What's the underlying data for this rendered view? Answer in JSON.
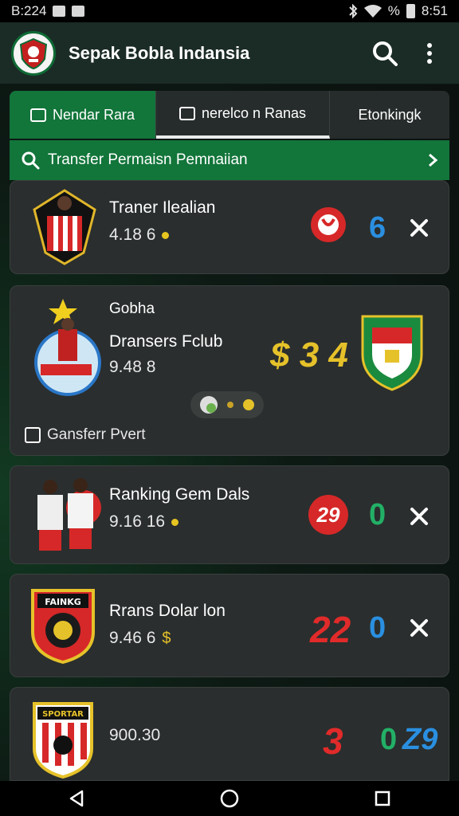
{
  "status_bar": {
    "time_left": "B:224",
    "battery": "%",
    "time_right": "8:51"
  },
  "app_bar": {
    "title": "Sepak Bobla Indansia"
  },
  "tabs": [
    {
      "label": "Nendar Rara"
    },
    {
      "label": "nerelco n Ranas"
    },
    {
      "label": "Etonkingk"
    }
  ],
  "search": {
    "label": "Transfer Permaisn Pemnaiian"
  },
  "cards": [
    {
      "name": "Traner Ilealian",
      "meta": "4.18 6",
      "score": "6"
    },
    {
      "subtitle": "Gobha",
      "name": "Dransers Fclub",
      "meta": "9.48 8",
      "score": "$ 3 4",
      "checkbox_label": "Gansferr Pvert"
    },
    {
      "name": "Ranking Gem Dals",
      "meta": "9.16 16",
      "score_red": "29",
      "score": "0"
    },
    {
      "name": "Rrans Dolar lon",
      "meta": "9.46 6",
      "meta_icon": "$",
      "score_red": "22",
      "score": "0"
    },
    {
      "meta": "900.30",
      "score_red": "3",
      "score": "0",
      "score_extra": "Z9",
      "crest_label": "SPORTAR"
    }
  ],
  "crest_labels": {
    "card4": "FAINKG"
  },
  "colors": {
    "accent_green": "#12753a",
    "score_blue": "#2a8fe0",
    "score_green": "#22b066",
    "score_red": "#e12a2a"
  }
}
